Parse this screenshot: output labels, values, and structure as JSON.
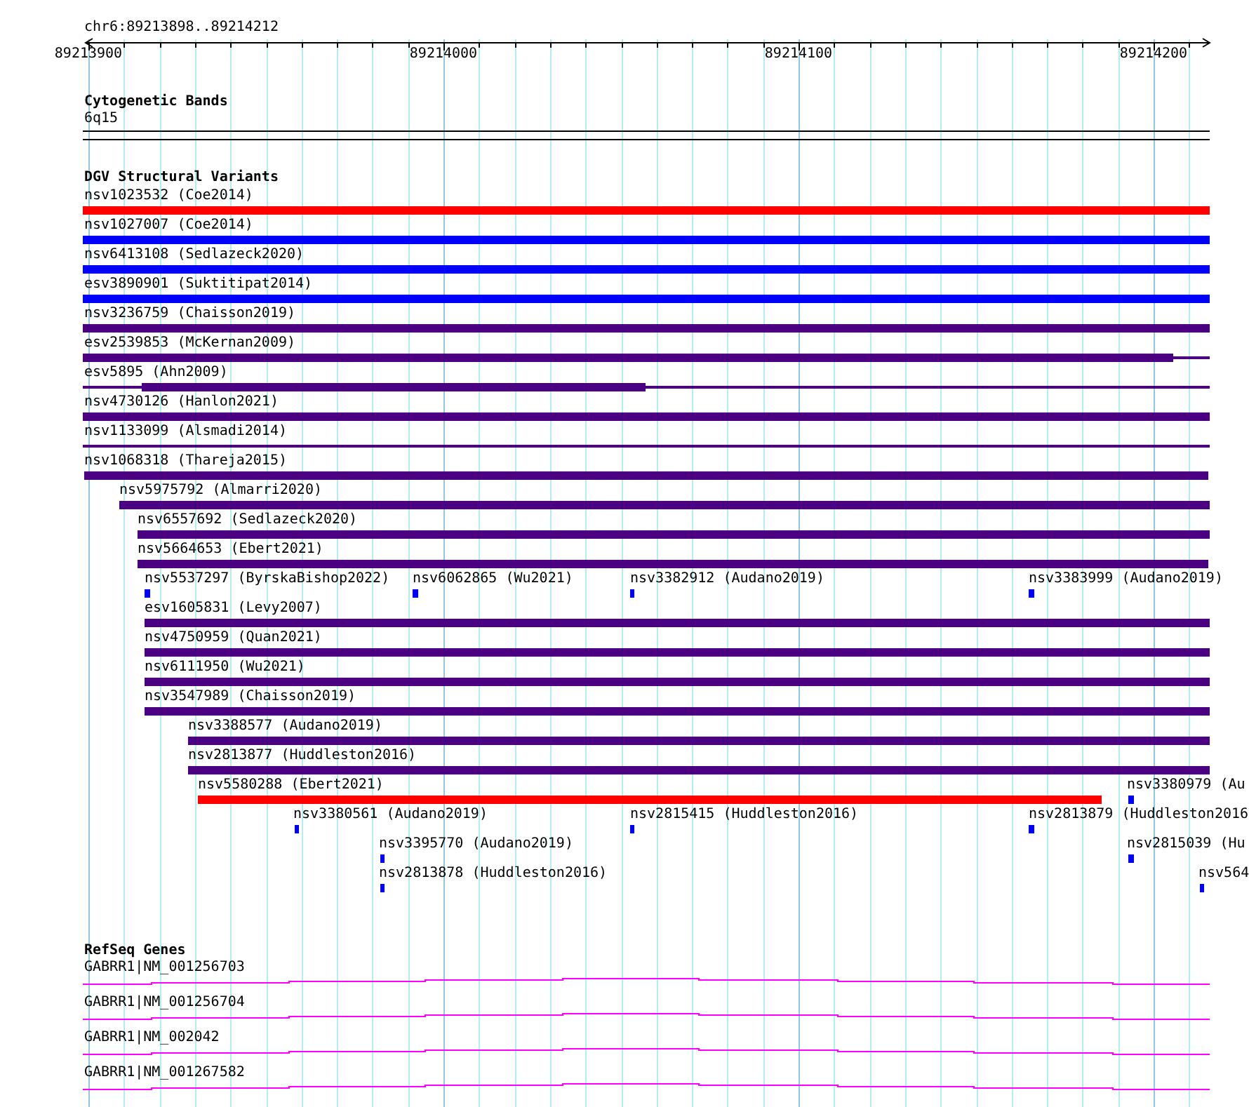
{
  "ruler": {
    "location": "chr6:89213898..89214212",
    "ticks": [
      "89213900",
      "89214000",
      "89214100",
      "89214200"
    ]
  },
  "tracks": [
    {
      "kind": "bands",
      "title": "Cytogenetic Bands",
      "features": [
        {
          "label": "6q15"
        }
      ]
    },
    {
      "kind": "variants",
      "title": "DGV Structural Variants",
      "features": [
        {
          "label": "nsv1023532 (Coe2014)",
          "color": "#ff0000"
        },
        {
          "label": "nsv1027007 (Coe2014)",
          "color": "#0000ff"
        },
        {
          "label": "nsv6413108 (Sedlazeck2020)",
          "color": "#0000ff"
        },
        {
          "label": "esv3890901 (Suktitipat2014)",
          "color": "#0000ff"
        },
        {
          "label": "nsv3236759 (Chaisson2019)",
          "color": "#4b0082"
        },
        {
          "label": "esv2539853 (McKernan2009)",
          "color": "#4b0082"
        },
        {
          "label": "esv5895 (Ahn2009)",
          "color": "#4b0082"
        },
        {
          "label": "nsv4730126 (Hanlon2021)",
          "color": "#4b0082"
        },
        {
          "label": "nsv1133099 (Alsmadi2014)",
          "color": "#4b0082"
        },
        {
          "label": "nsv1068318 (Thareja2015)",
          "color": "#4b0082"
        },
        {
          "label": "nsv5975792 (Almarri2020)",
          "color": "#4b0082"
        },
        {
          "label": "nsv6557692 (Sedlazeck2020)",
          "color": "#4b0082"
        },
        {
          "label": "nsv5664653 (Ebert2021)",
          "color": "#4b0082"
        },
        {
          "label": "nsv5537297 (ByrskaBishop2022)",
          "color": "#0000ff"
        },
        {
          "label": "nsv6062865 (Wu2021)",
          "color": "#0000ff"
        },
        {
          "label": "nsv3382912 (Audano2019)",
          "color": "#0000ff"
        },
        {
          "label": "nsv3383999 (Audano2019)",
          "color": "#0000ff"
        },
        {
          "label": "esv1605831 (Levy2007)",
          "color": "#4b0082"
        },
        {
          "label": "nsv4750959 (Quan2021)",
          "color": "#4b0082"
        },
        {
          "label": "nsv6111950 (Wu2021)",
          "color": "#4b0082"
        },
        {
          "label": "nsv3547989 (Chaisson2019)",
          "color": "#4b0082"
        },
        {
          "label": "nsv3388577 (Audano2019)",
          "color": "#4b0082"
        },
        {
          "label": "nsv2813877 (Huddleston2016)",
          "color": "#4b0082"
        },
        {
          "label": "nsv5580288 (Ebert2021)",
          "color": "#ff0000"
        },
        {
          "label": "nsv3380979 (Au",
          "color": "#0000ff"
        },
        {
          "label": "nsv3380561 (Audano2019)",
          "color": "#0000ff"
        },
        {
          "label": "nsv2815415 (Huddleston2016)",
          "color": "#0000ff"
        },
        {
          "label": "nsv2813879 (Huddleston2016",
          "color": "#0000ff"
        },
        {
          "label": "nsv3395770 (Audano2019)",
          "color": "#0000ff"
        },
        {
          "label": "nsv2815039 (Hu",
          "color": "#0000ff"
        },
        {
          "label": "nsv2813878 (Huddleston2016)",
          "color": "#0000ff"
        },
        {
          "label": "nsv564",
          "color": "#0000ff"
        }
      ]
    },
    {
      "kind": "genes",
      "title": "RefSeq Genes",
      "features": [
        {
          "label": "GABRR1|NM_001256703"
        },
        {
          "label": "GABRR1|NM_001256704"
        },
        {
          "label": "GABRR1|NM_002042"
        },
        {
          "label": "GABRR1|NM_001267582"
        }
      ]
    }
  ]
}
